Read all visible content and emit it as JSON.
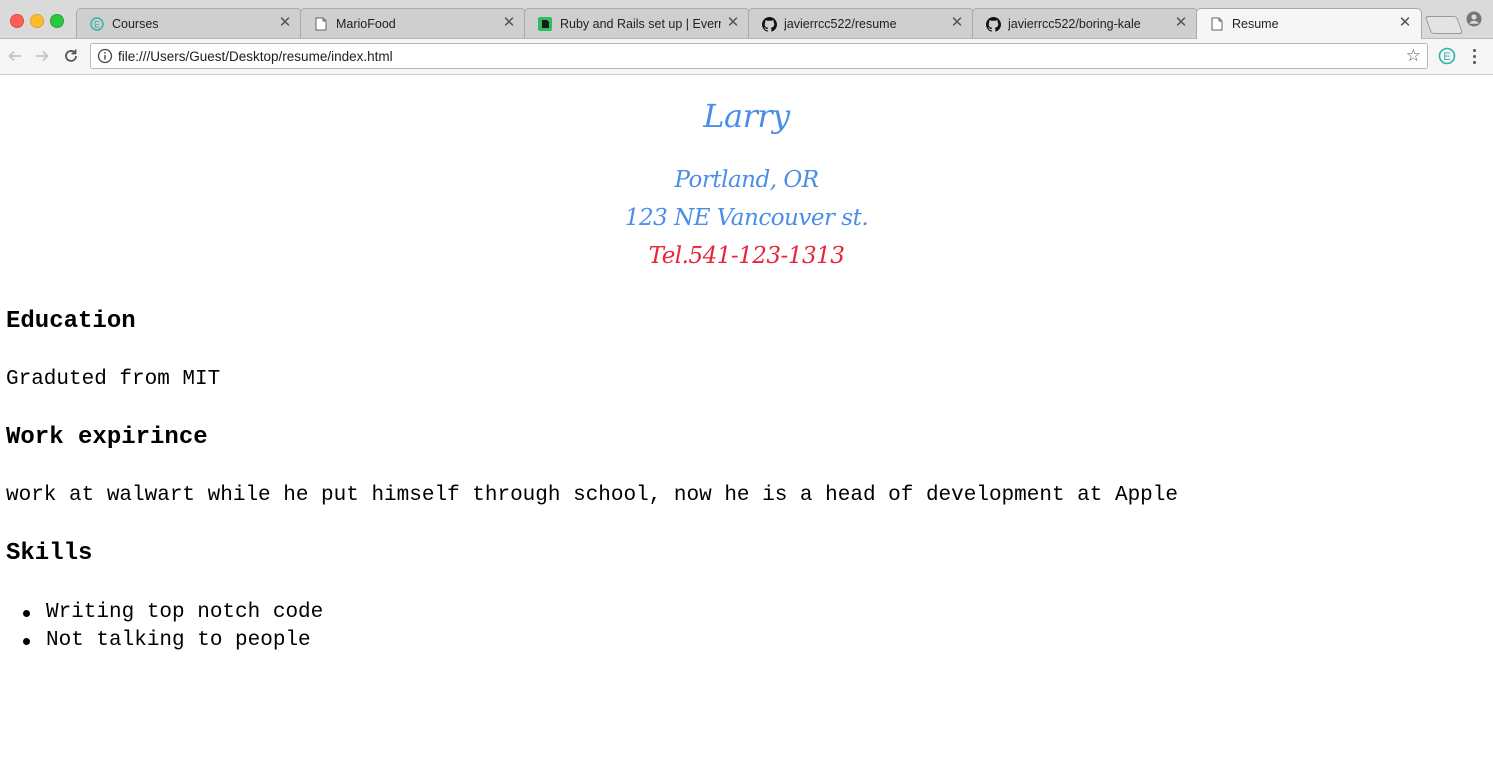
{
  "browser": {
    "tabs": [
      {
        "label": "Courses",
        "icon": "evernote-e-icon"
      },
      {
        "label": "MarioFood",
        "icon": "page-icon"
      },
      {
        "label": "Ruby and Rails set up | Everno",
        "icon": "evernote-icon"
      },
      {
        "label": "javierrcc522/resume",
        "icon": "github-icon"
      },
      {
        "label": "javierrcc522/boring-kale",
        "icon": "github-icon"
      },
      {
        "label": "Resume",
        "icon": "page-icon"
      }
    ],
    "active_tab_index": 5,
    "url": "file:///Users/Guest/Desktop/resume/index.html"
  },
  "resume": {
    "name": "Larry",
    "city": "Portland, OR",
    "street": "123 NE Vancouver st.",
    "tel": "Tel.541-123-1313",
    "education_heading": "Education",
    "education_text": "Graduted from MIT",
    "work_heading": "Work expirince",
    "work_text": "work at walwart while he put himself through school, now he is a head of development at Apple",
    "skills_heading": "Skills",
    "skills": [
      "Writing top notch code",
      "Not talking to people"
    ]
  },
  "colors": {
    "header_blue": "#4b8ee8",
    "tel_red": "#e8243a"
  }
}
